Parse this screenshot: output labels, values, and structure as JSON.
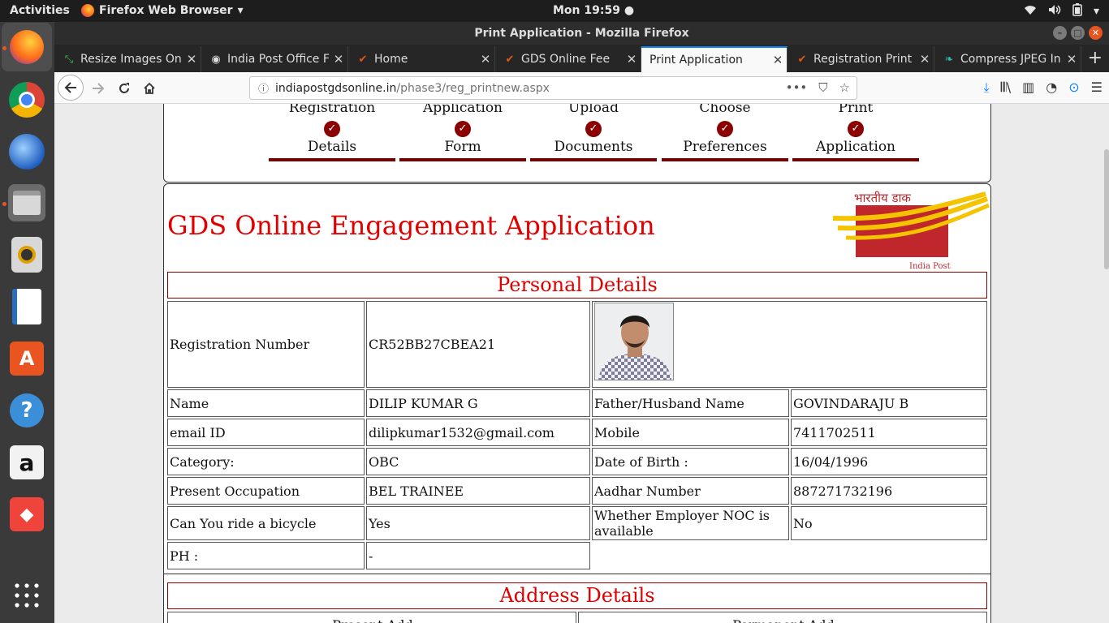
{
  "topbar": {
    "activities": "Activities",
    "app_name": "Firefox Web Browser",
    "clock": "Mon 19:59"
  },
  "window": {
    "title": "Print Application - Mozilla Firefox"
  },
  "tabs": [
    {
      "title": "Resize Images Onl",
      "icon": "resize-icon"
    },
    {
      "title": "India Post Office F",
      "icon": "globe-icon"
    },
    {
      "title": "Home",
      "icon": "checkmark-icon"
    },
    {
      "title": "GDS Online Fee",
      "icon": "checkmark-icon"
    },
    {
      "title": "Print Application",
      "icon": "none",
      "active": true
    },
    {
      "title": "Registration Print",
      "icon": "checkmark-icon"
    },
    {
      "title": "Compress JPEG In",
      "icon": "leaf-icon"
    }
  ],
  "urlbar": {
    "host": "indiapostgdsonline.in",
    "path": "/phase3/reg_printnew.aspx"
  },
  "steps": [
    {
      "line1": "Registration",
      "line2": "Details"
    },
    {
      "line1": "Application",
      "line2": "Form"
    },
    {
      "line1": "Upload",
      "line2": "Documents"
    },
    {
      "line1": "Choose",
      "line2": "Preferences"
    },
    {
      "line1": "Print",
      "line2": "Application"
    }
  ],
  "form": {
    "title": "GDS Online Engagement Application",
    "logo_hindi": "भारतीय डाक",
    "logo_english": "India Post",
    "personal_details": "Personal Details",
    "address_details": "Address Details",
    "address_col1": "Present Add",
    "address_col2": "Permanent Add"
  },
  "personal": {
    "reg_label": "Registration Number",
    "reg_value": "CR52BB27CBEA21",
    "name_label": "Name",
    "name_value": "DILIP KUMAR G",
    "father_label": "Father/Husband Name",
    "father_value": "GOVINDARAJU B",
    "email_label": "email ID",
    "email_value": "dilipkumar1532@gmail.com",
    "mobile_label": "Mobile",
    "mobile_value": "7411702511",
    "category_label": "Category:",
    "category_value": "OBC",
    "dob_label": "Date of Birth :",
    "dob_value": "16/04/1996",
    "occupation_label": "Present Occupation",
    "occupation_value": "BEL TRAINEE",
    "aadhar_label": "Aadhar Number",
    "aadhar_value": "887271732196",
    "bicycle_label": "Can You ride a bicycle",
    "bicycle_value": "Yes",
    "noc_label": "Whether Employer NOC is available",
    "noc_value": "No",
    "ph_label": "PH :",
    "ph_value": "-"
  },
  "colors": {
    "accent_red": "#e00000",
    "step_red": "#8b0000",
    "ubuntu_orange": "#e95420",
    "firefox_blue": "#0a84ff"
  }
}
